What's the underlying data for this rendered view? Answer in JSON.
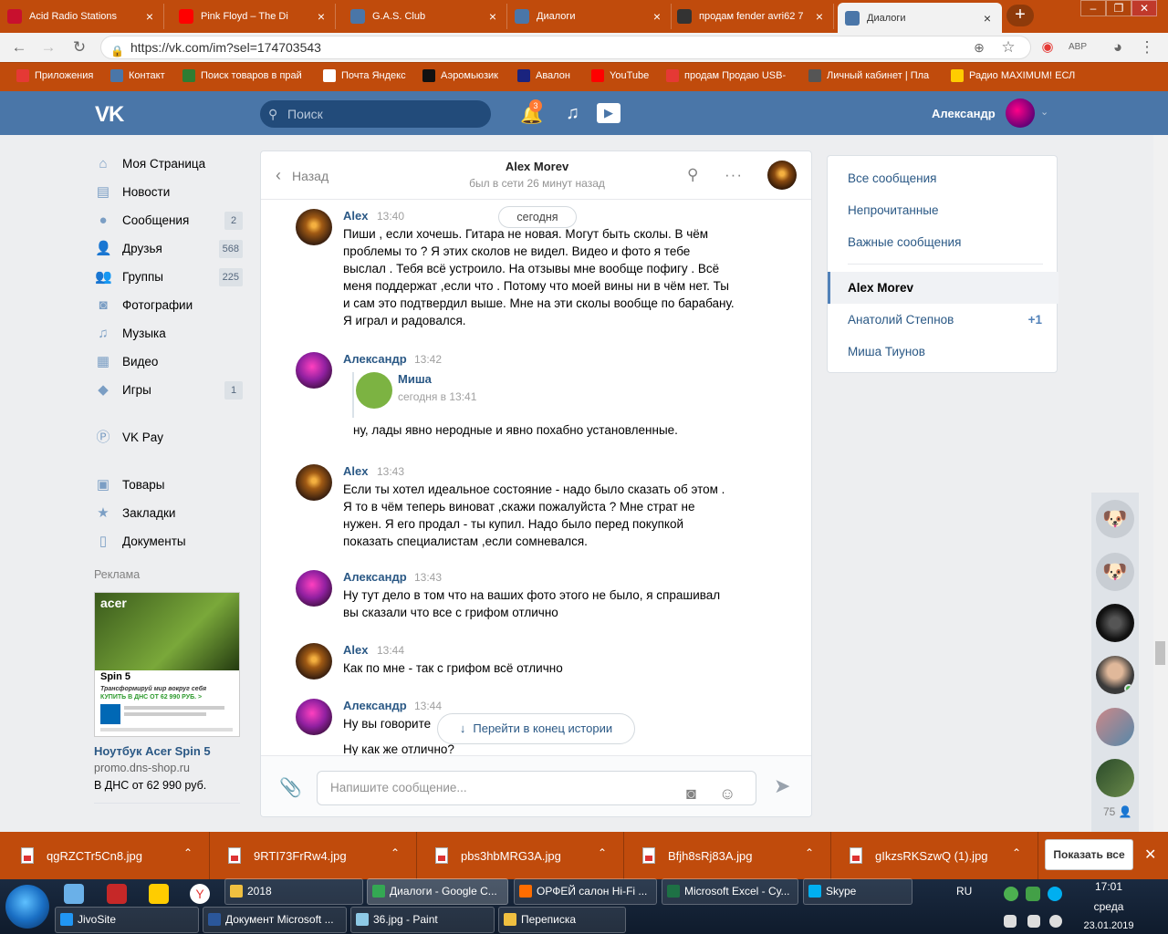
{
  "browser": {
    "tabs": [
      {
        "title": "Acid Radio Stations",
        "color": "#c8102e",
        "icon": "a-icon"
      },
      {
        "title": "Pink Floyd – The Di",
        "color": "#ff0000",
        "icon": "youtube-icon"
      },
      {
        "title": "G.A.S. Club",
        "color": "#4a76a8",
        "icon": "vk-icon"
      },
      {
        "title": "Диалоги",
        "color": "#4a76a8",
        "icon": "message-icon"
      },
      {
        "title": "продам fender avri62 7",
        "color": "#333333",
        "icon": "guitar-icon"
      },
      {
        "title": "Диалоги",
        "color": "#4a76a8",
        "icon": "message-icon"
      }
    ],
    "url": "https://vk.com/im?sel=174703543",
    "bookmarks": [
      {
        "label": "Приложения",
        "color": "#e53935"
      },
      {
        "label": "Контакт",
        "color": "#4a76a8"
      },
      {
        "label": "Поиск товаров в прай",
        "color": "#2e7d32"
      },
      {
        "label": "Почта Яндекс",
        "color": "#ffffff"
      },
      {
        "label": "Аэромьюзик",
        "color": "#111111"
      },
      {
        "label": "Авалон",
        "color": "#1a237e"
      },
      {
        "label": "YouTube",
        "color": "#ff0000"
      },
      {
        "label": "продам Продаю USB-",
        "color": "#e53935"
      },
      {
        "label": "Личный кабинет | Пла",
        "color": "#555555"
      },
      {
        "label": "Радио MAXIMUM! ЕСЛ",
        "color": "#ffcc00"
      }
    ]
  },
  "vk": {
    "search_placeholder": "Поиск",
    "notifications_count": "3",
    "user_name": "Александр"
  },
  "left_menu": [
    {
      "label": "Моя Страница",
      "icon": "home-icon",
      "glyph": "⌂",
      "count": ""
    },
    {
      "label": "Новости",
      "icon": "news-icon",
      "glyph": "▤",
      "count": ""
    },
    {
      "label": "Сообщения",
      "icon": "messages-icon",
      "glyph": "●",
      "count": "2"
    },
    {
      "label": "Друзья",
      "icon": "friends-icon",
      "glyph": "👤",
      "count": "568"
    },
    {
      "label": "Группы",
      "icon": "groups-icon",
      "glyph": "👥",
      "count": "225"
    },
    {
      "label": "Фотографии",
      "icon": "camera-icon",
      "glyph": "◙",
      "count": ""
    },
    {
      "label": "Музыка",
      "icon": "music-icon",
      "glyph": "♫",
      "count": ""
    },
    {
      "label": "Видео",
      "icon": "video-icon",
      "glyph": "▦",
      "count": ""
    },
    {
      "label": "Игры",
      "icon": "games-icon",
      "glyph": "◆",
      "count": "1"
    },
    {
      "label": "VK Pay",
      "icon": "vkpay-icon",
      "glyph": "Ⓟ",
      "count": ""
    },
    {
      "label": "Товары",
      "icon": "bag-icon",
      "glyph": "▣",
      "count": ""
    },
    {
      "label": "Закладки",
      "icon": "star-icon",
      "glyph": "★",
      "count": ""
    },
    {
      "label": "Документы",
      "icon": "document-icon",
      "glyph": "▯",
      "count": ""
    }
  ],
  "ad": {
    "section_title": "Реклама",
    "brand": "acer",
    "product_caption": "Spin 5",
    "tagline": "Трансформируй мир вокруг себя",
    "cta": "КУПИТЬ В ДНС ОТ 62 990 РУБ. >",
    "name": "Ноутбук Acer Spin 5",
    "domain": "promo.dns-shop.ru",
    "text": "В ДНС от 62 990 руб."
  },
  "chat": {
    "back_label": "Назад",
    "peer_name": "Alex Morev",
    "peer_status": "был в сети 26 минут назад",
    "date_divider": "сегодня",
    "messages": [
      {
        "author": "Alex",
        "time": "13:40",
        "avatar": "alex",
        "text": "Пиши , если хочешь. Гитара не новая. Могут быть сколы. В чём проблемы то ? Я этих сколов не видел. Видео и фото я тебе выслал . Тебя всё устроило. На отзывы мне вообще пофигу . Всё меня поддержат ,если что . Потому что моей вины ни в чём нет. Ты и сам это подтвердил выше. Мне на эти сколы вообще по барабану. Я играл и радовался."
      },
      {
        "author": "Александр",
        "time": "13:42",
        "avatar": "al",
        "forward": {
          "name": "Миша",
          "date": "сегодня в 13:41",
          "text": "ну, лады явно неродные и явно похабно установленные."
        }
      },
      {
        "author": "Alex",
        "time": "13:43",
        "avatar": "alex",
        "text": "Если ты хотел идеальное состояние - надо было сказать об этом . Я то в чём теперь виноват ,скажи пожалуйста ? Мне страт не нужен. Я его продал - ты купил. Надо было перед покупкой показать специалистам ,если сомневался."
      },
      {
        "author": "Александр",
        "time": "13:43",
        "avatar": "al",
        "text": "Ну тут дело в том что на ваших фото этого не было, я спрашивал вы сказали что все с грифом отлично"
      },
      {
        "author": "Alex",
        "time": "13:44",
        "avatar": "alex",
        "text": "Как по мне - так с грифом всё отлично"
      },
      {
        "author": "Александр",
        "time": "13:44",
        "avatar": "al",
        "text": "Ну вы говорите",
        "text2": "Ну как же отлично?"
      }
    ],
    "goto_end_label": "Перейти в конец истории",
    "composer_placeholder": "Напишите сообщение..."
  },
  "right_menu": {
    "filters": [
      "Все сообщения",
      "Непрочитанные",
      "Важные сообщения"
    ],
    "dialogs": [
      {
        "name": "Alex Morev",
        "badge": "",
        "selected": true
      },
      {
        "name": "Анатолий Степнов",
        "badge": "+1",
        "selected": false
      },
      {
        "name": "Миша Тиунов",
        "badge": "",
        "selected": false
      }
    ]
  },
  "chats_bar": {
    "count": "75"
  },
  "downloads": {
    "files": [
      "qgRZCTr5Cn8.jpg",
      "9RTI73FrRw4.jpg",
      "pbs3hbMRG3A.jpg",
      "Bfjh8sRj83A.jpg",
      "gIkzsRKSzwQ (1).jpg"
    ],
    "show_all": "Показать все"
  },
  "taskbar": {
    "row1": [
      {
        "label": "2018",
        "color": "#f0c040"
      },
      {
        "label": "Диалоги - Google C...",
        "color": "#34a853"
      },
      {
        "label": "ОРФЕЙ салон Hi-Fi ...",
        "color": "#ff6d00"
      },
      {
        "label": "Microsoft Excel - Су...",
        "color": "#1e7145"
      },
      {
        "label": "Skype",
        "color": "#00aff0"
      }
    ],
    "row2": [
      {
        "label": "JivoSite",
        "color": "#2196f3"
      },
      {
        "label": "Документ Microsoft ...",
        "color": "#2b579a"
      },
      {
        "label": "36.jpg - Paint",
        "color": "#8ecae6"
      },
      {
        "label": "Переписка",
        "color": "#f0c040"
      }
    ],
    "lang": "RU",
    "time": "17:01",
    "weekday": "среда",
    "date": "23.01.2019"
  }
}
